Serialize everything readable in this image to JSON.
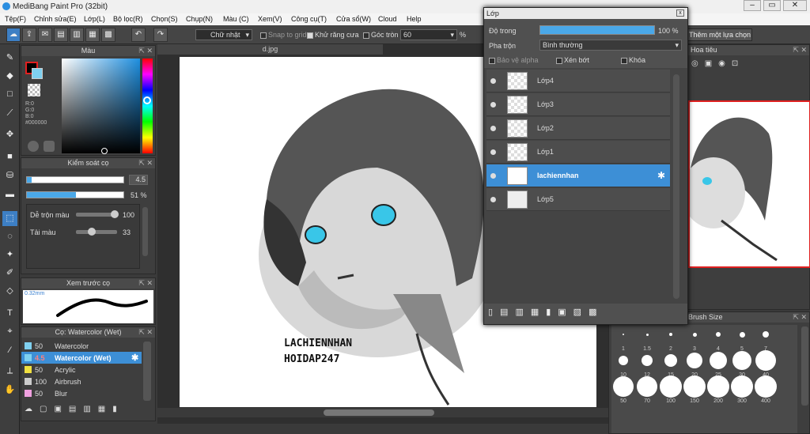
{
  "app_title": "MediBang Paint Pro (32bit)",
  "menu": [
    "Tệp(F)",
    "Chỉnh sửa(E)",
    "Lớp(L)",
    "Bộ lọc(R)",
    "Chọn(S)",
    "Chụp(N)",
    "Màu (C)",
    "Xem(V)",
    "Công cụ(T)",
    "Cửa sổ(W)",
    "Cloud",
    "Help"
  ],
  "toolbar": {
    "select_mode": "Chữ nhật",
    "snap": "Snap to grid",
    "antialias": "Khử răng cưa",
    "round": "Góc tròn",
    "round_value": "60",
    "percent": "%",
    "add_selection": "Thêm một lựa chọn"
  },
  "color_panel": {
    "title": "Màu",
    "r": "R:0",
    "g": "G:0",
    "b": "B:0",
    "hex": "#000000"
  },
  "brush_control": {
    "title": "Kiểm soát cọ",
    "size": "4.5",
    "opacity": "51 %",
    "mix_label": "Dễ trộn màu",
    "mix_value": "100",
    "refill_label": "Tải màu",
    "refill_value": "33",
    "size_fill": 0.05,
    "opacity_fill": 0.51,
    "mix_fill": 1.0,
    "refill_fill": 0.33
  },
  "brush_preview": {
    "title": "Xem trước cọ",
    "size": "0.32mm"
  },
  "brush_list": {
    "title": "Cọ: Watercolor (Wet)",
    "items": [
      {
        "size": "50",
        "name": "Watercolor",
        "color": "#7fd0f0"
      },
      {
        "size": "4.5",
        "name": "Watercolor (Wet)",
        "color": "#7fd0f0"
      },
      {
        "size": "50",
        "name": "Acrylic",
        "color": "#f0e040"
      },
      {
        "size": "100",
        "name": "Airbrush",
        "color": "#cccccc"
      },
      {
        "size": "50",
        "name": "Blur",
        "color": "#f0a0e0"
      }
    ]
  },
  "canvas": {
    "tab": "d.jpg",
    "text1": "LACHIENNHAN",
    "text2": "HOIDAP247"
  },
  "layer_panel": {
    "title": "Lớp",
    "opacity_label": "Độ trong",
    "opacity_value": "100 %",
    "blend_label": "Pha trộn",
    "blend_value": "Bình thường",
    "protect_alpha": "Bảo vệ alpha",
    "clipping": "Xén bớt",
    "lock": "Khóa",
    "layers": [
      "Lớp4",
      "Lớp3",
      "Lớp2",
      "Lớp1",
      "lachiennhan",
      "Lớp5"
    ]
  },
  "navigator": {
    "title": "Hoa tiêu"
  },
  "brush_size": {
    "title": "Brush Size",
    "sizes": [
      "1",
      "1.5",
      "2",
      "3",
      "4",
      "5",
      "7",
      "10",
      "12",
      "15",
      "20",
      "25",
      "30",
      "40",
      "50",
      "70",
      "100",
      "150",
      "200",
      "300",
      "400"
    ]
  }
}
